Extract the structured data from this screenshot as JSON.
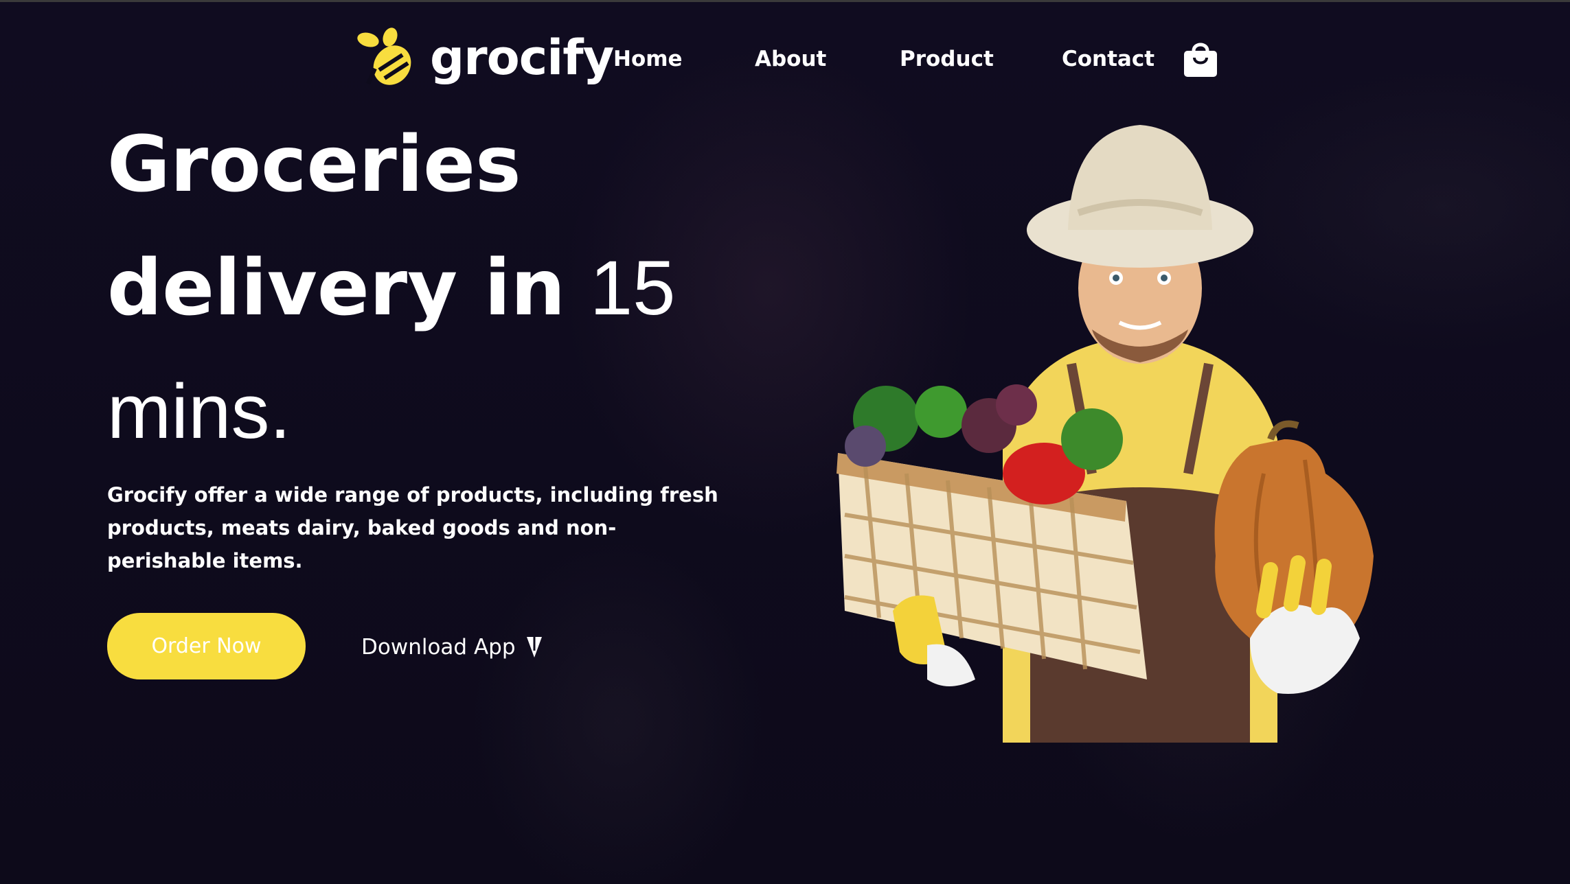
{
  "brand": {
    "name": "grocify",
    "accent": "#f8dd3f"
  },
  "nav": {
    "items": [
      {
        "label": "Home"
      },
      {
        "label": "About"
      },
      {
        "label": "Product"
      },
      {
        "label": "Contact"
      }
    ],
    "cart_icon": "shopping-bag-icon"
  },
  "hero": {
    "title_line1": "Groceries",
    "title_line2_bold": "delivery in",
    "title_line2_light": "15",
    "title_line3": "mins.",
    "description": "Grocify offer a wide range of products, including fresh products, meats dairy, baked goods and non-perishable items.",
    "order_button": "Order Now",
    "download_link": "Download App",
    "download_icon": "arrow-cursor-icon"
  },
  "colors": {
    "background": "#0e0b1c",
    "button": "#f8dd3f"
  }
}
